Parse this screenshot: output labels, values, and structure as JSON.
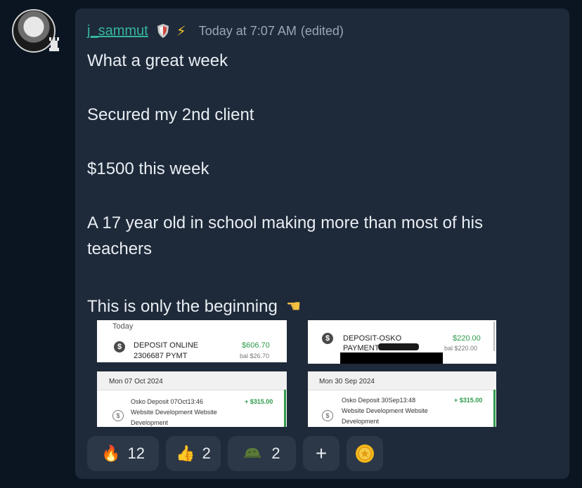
{
  "message": {
    "username": "j_sammut",
    "timestamp": "Today at 7:07 AM",
    "edited": "(edited)",
    "lines": [
      "What a great week",
      "Secured my 2nd client",
      "$1500 this week",
      "A 17 year old in school making more than most of his",
      "teachers",
      "This is only the beginning"
    ]
  },
  "cards": {
    "card1": {
      "day": "Today",
      "desc1": "DEPOSIT ONLINE",
      "desc2": "2306687 PYMT",
      "amount": "$606.70",
      "bal": "bal $26.70"
    },
    "card2": {
      "desc1": "DEPOSIT-OSKO",
      "desc2": "PAYMENT",
      "amount": "$220.00",
      "bal": "bal $220.00"
    },
    "card3": {
      "date": "Mon 07 Oct 2024",
      "line1": "Osko Deposit 07Oct13:46",
      "line2": "Website Development Website",
      "line3": "Development",
      "amount": "+ $315.00"
    },
    "card4": {
      "date": "Mon 30 Sep 2024",
      "line1": "Osko Deposit 30Sep13:48",
      "line2": "Website Development Website",
      "line3": "Development",
      "amount": "+ $315.00"
    }
  },
  "reactions": [
    {
      "icon": "fire-icon",
      "count": "12"
    },
    {
      "icon": "thumbs-up-icon",
      "count": "2"
    },
    {
      "icon": "helmet-icon",
      "count": "2"
    }
  ],
  "add_reaction": "+",
  "colors": {
    "username": "#35b59b",
    "bubble": "#1e2a3a",
    "background": "#0b1522",
    "reaction_bg": "#2c3847"
  }
}
